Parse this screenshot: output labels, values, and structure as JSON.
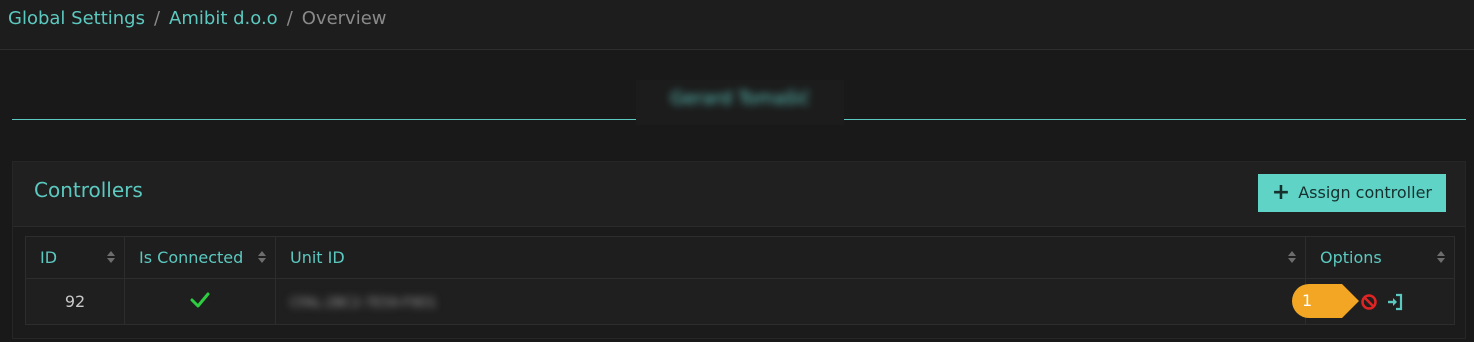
{
  "breadcrumb": {
    "items": [
      {
        "label": "Global Settings"
      },
      {
        "label": "Amibit d.o.o"
      }
    ],
    "separator": "/",
    "current": "Overview"
  },
  "tab": {
    "label": "Gerard Tomašić"
  },
  "card": {
    "title": "Controllers",
    "assign_button_label": "Assign controller"
  },
  "table": {
    "columns": [
      "ID",
      "Is Connected",
      "Unit ID",
      "Options"
    ],
    "rows": [
      {
        "id": "92",
        "is_connected": "check-icon",
        "unit_id": "CFAL-2BC2-7E59-F9D1",
        "option_badge": "1"
      }
    ]
  },
  "colors": {
    "accent": "#5cc9c0",
    "button_bg": "#5ed3c6",
    "danger": "#e02424",
    "success": "#2ecc40",
    "badge": "#f2a623"
  }
}
